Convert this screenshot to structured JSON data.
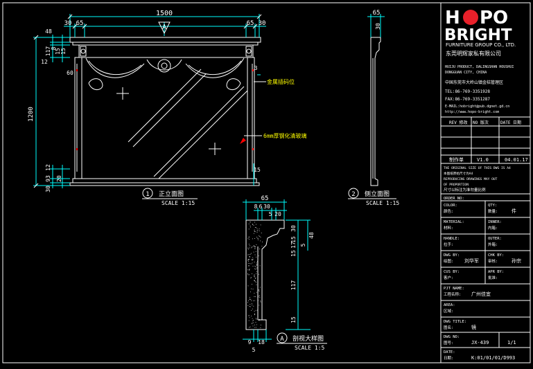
{
  "brand": {
    "logo_top_left": "H",
    "logo_top_right": "PO",
    "logo_bottom": "BRIGHT",
    "company_en": "FURNITURE GROUP CO., LTD.",
    "company_cn": "东莞明辉家私有限公司",
    "address_en_1": "HUIJU PRODUCT, DALINGSHAN HOUSHUI",
    "address_en_2": "DONGGUAN CITY, CHINA",
    "address_cn": "中国东莞市大岭山镇金桔管理区",
    "tel": "TEL:86-769-3351928",
    "fax": "FAX:86-769-3351287",
    "email": "E-MAIL:hobright@pub.dgnet.gd.cn",
    "web": "http://www.hopo-bright.com"
  },
  "colors": {
    "background": "#000000",
    "geometry": "#ffffff",
    "dimension": "#00ffff",
    "dim_text": "#ffffff",
    "annotation": "#ffff00",
    "table_line": "#ffffff",
    "logo_red": "#e8202a",
    "callout_red": "#ff0000"
  },
  "front": {
    "overall_width": "1500",
    "top_dims": [
      "30",
      "65",
      "65",
      "30"
    ],
    "overall_height": "1200",
    "left_dims": [
      "48",
      "117",
      "8",
      "15",
      "12",
      "15"
    ],
    "left_60": "60",
    "bottom_dims": [
      "12",
      "93",
      "30",
      "20"
    ],
    "right_3": "3",
    "right_15": "15",
    "section_marker": "A",
    "note_gold": "金属插码位",
    "note_glass": "6mm厚钢化清玻璃",
    "view_number": "1",
    "view_title": "正立面图",
    "scale": "SCALE 1:15"
  },
  "side": {
    "top_65": "65",
    "top_30": "30",
    "view_number": "2",
    "view_title": "侧立面图",
    "scale": "SCALE 1:15"
  },
  "detail": {
    "top_65": "65",
    "top_dims": [
      "8",
      "6",
      "30",
      "5",
      "20"
    ],
    "right_dims": [
      "30",
      "48",
      "15",
      "17",
      "5",
      "15",
      "117",
      "15"
    ],
    "bottom_dims": [
      "9",
      "18",
      "5"
    ],
    "view_letter": "A",
    "view_title": "剖视大样图",
    "scale": "SCALE 1:5"
  },
  "title_block": {
    "rev_header": "REV 修改",
    "no_header": "NO 版次",
    "date_header": "DATE 日期",
    "rev_row": "制作单",
    "rev_val": "V1.0",
    "rev_date": "04.01.17",
    "copyright_1": "THE ORIGINAL SIZE OF THIS DWG IS A4",
    "copyright_1b": "本图纸原始尺寸为A4",
    "copyright_2": "REPRODUCING DRAWINGS MAY OUT",
    "copyright_2b": "OF PROPORTION",
    "copyright_3": "尺寸以标注为准勿量比例",
    "rows": [
      {
        "label": "ORDER NO:",
        "label_cn": "单号:",
        "value": ""
      },
      {
        "label": "COLOR:",
        "label_cn": "颜色:",
        "label2": "QTY:",
        "label2_cn": "数量:",
        "value2": "件"
      },
      {
        "label": "MATERIAL:",
        "label_cn": "材料:",
        "label2": "INNER:",
        "label2_cn": "内箱:",
        "value": ""
      },
      {
        "label": "HANDLE:",
        "label_cn": "拉手:",
        "label2": "OUTER:",
        "label2_cn": "外箱:",
        "value": ""
      },
      {
        "label": "DWG BY:",
        "label_cn": "绘图:",
        "value": "刘华军",
        "label2": "CHK BY:",
        "label2_cn": "审核:",
        "value2": "孙宗"
      },
      {
        "label": "CUS BY:",
        "label_cn": "客户:",
        "label2": "APR BY:",
        "label2_cn": "批准:",
        "value": ""
      },
      {
        "label": "PJT NAME:",
        "label_cn": "工程名称:",
        "value": "广州佳宜"
      },
      {
        "label": "AREA:",
        "label_cn": "区域:",
        "value": ""
      },
      {
        "label": "DWG TITLE:",
        "label_cn": "图名:",
        "value": "镜"
      },
      {
        "label": "DWG NO:",
        "label_cn": "图号:",
        "value": "JX-439",
        "value2": "1/1"
      },
      {
        "label": "DATE:",
        "label_cn": "日期:",
        "value": "K:01/01/01/D993"
      }
    ]
  }
}
